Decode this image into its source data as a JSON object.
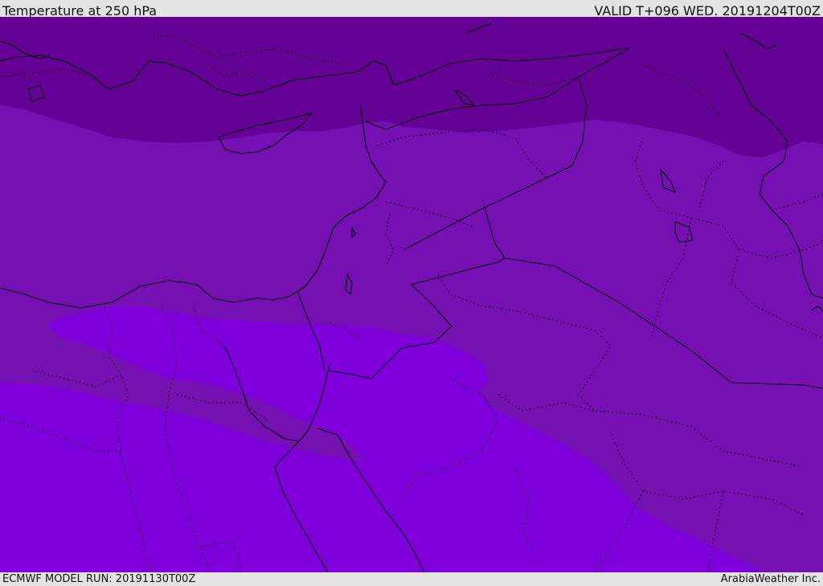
{
  "header": {
    "title": "Temperature at 250 hPa",
    "valid_time": "VALID T+096 WED. 20191204T00Z"
  },
  "footer": {
    "model_run": "ECMWF MODEL RUN: 20191130T00Z",
    "credit": "ArabiaWeather Inc."
  },
  "map": {
    "colors": {
      "band_cold": "#650296",
      "band_mid": "#7510b2",
      "band_warm": "#7e00db",
      "coastline": "#000000",
      "border": "#000000"
    }
  }
}
